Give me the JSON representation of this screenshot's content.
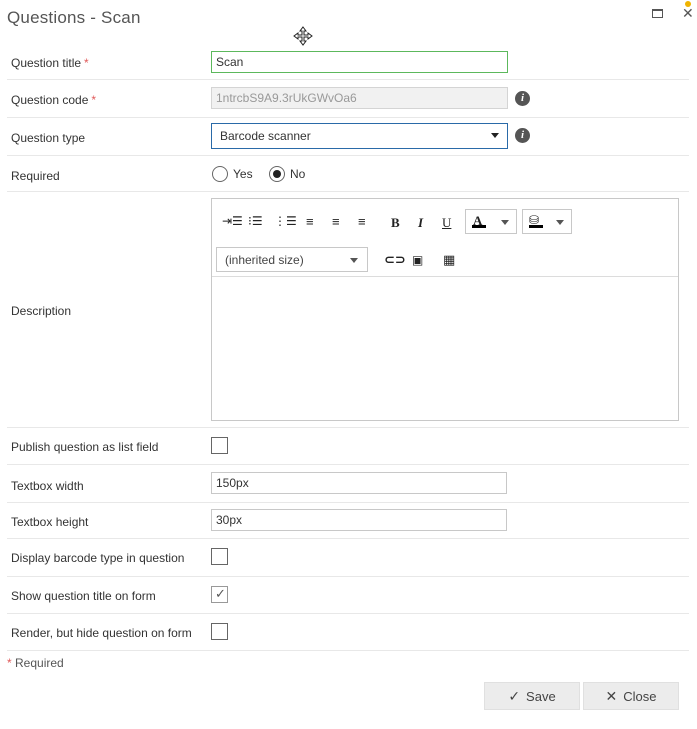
{
  "dialog": {
    "title": "Questions - Scan"
  },
  "fields": {
    "question_title": {
      "label": "Question title",
      "required_mark": "*",
      "value": "Scan"
    },
    "question_code": {
      "label": "Question code",
      "required_mark": "*",
      "value": "1ntrcbS9A9.3rUkGWvOa6"
    },
    "question_type": {
      "label": "Question type",
      "value": "Barcode scanner"
    },
    "required": {
      "label": "Required",
      "yes_label": "Yes",
      "no_label": "No",
      "selected": "No"
    },
    "description": {
      "label": "Description",
      "font_size_value": "(inherited size)",
      "text_color": "#000000",
      "highlight_color": "#000000"
    },
    "publish_as_list_field": {
      "label": "Publish question as list field",
      "checked": false
    },
    "textbox_width": {
      "label": "Textbox width",
      "value": "150px"
    },
    "textbox_height": {
      "label": "Textbox height",
      "value": "30px"
    },
    "display_barcode_type": {
      "label": "Display barcode type in question",
      "checked": false
    },
    "show_question_title": {
      "label": "Show question title on form",
      "checked": true
    },
    "render_hide": {
      "label": "Render, but hide question on form",
      "checked": false
    }
  },
  "footer": {
    "required_note_star": "*",
    "required_note": "Required",
    "save_label": "Save",
    "close_label": "Close"
  },
  "icons": {
    "maximize": "maximize-icon",
    "close": "close-icon",
    "info": "info-icon",
    "save": "checkmark-icon",
    "cancel": "x-icon"
  }
}
